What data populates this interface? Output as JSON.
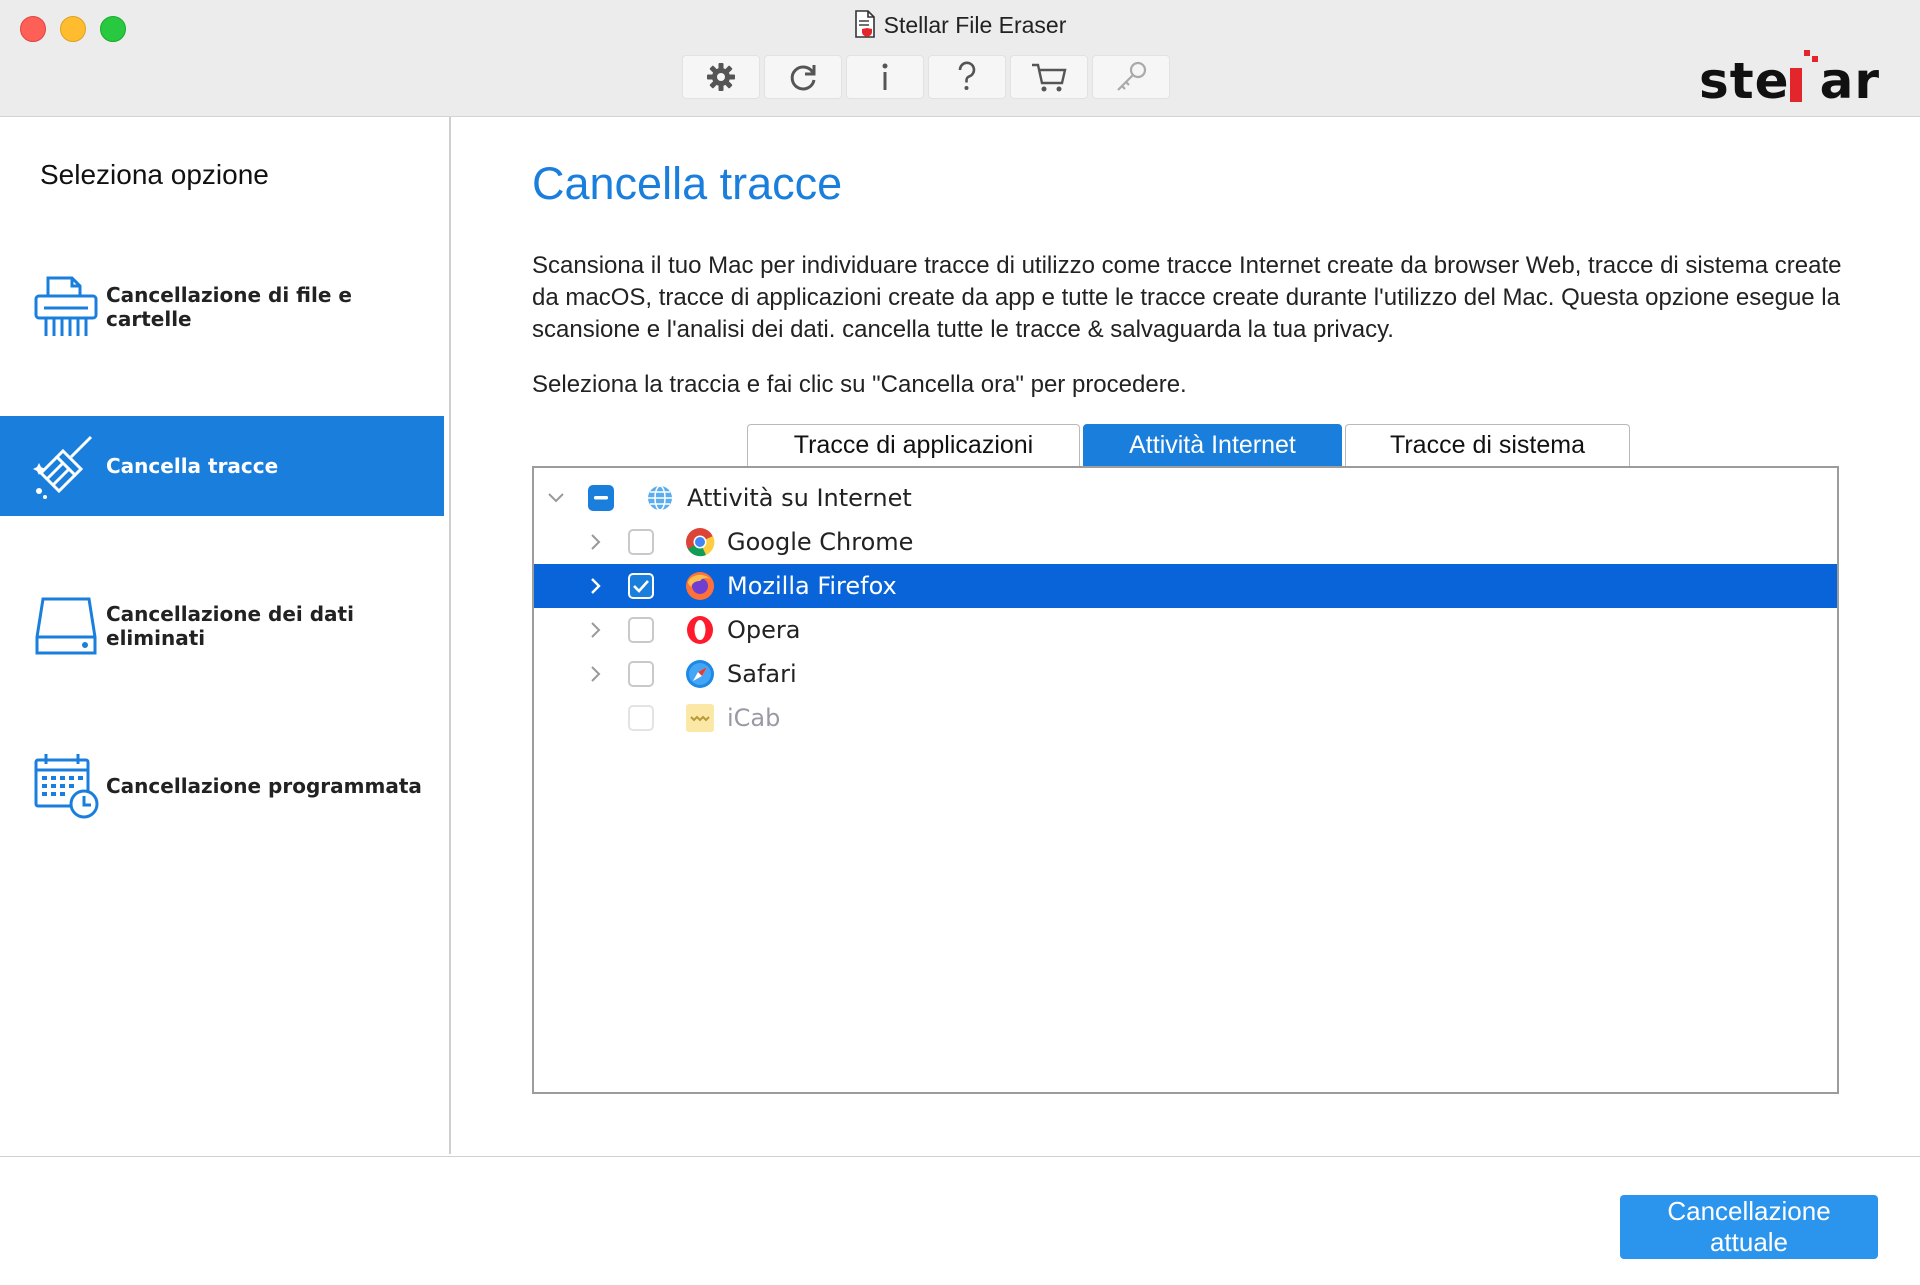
{
  "window": {
    "title": "Stellar File Eraser"
  },
  "toolbar": {
    "buttons": [
      {
        "icon": "gear-icon"
      },
      {
        "icon": "refresh-icon"
      },
      {
        "icon": "info-icon"
      },
      {
        "icon": "help-icon"
      },
      {
        "icon": "cart-icon"
      },
      {
        "icon": "key-icon"
      }
    ]
  },
  "brand": {
    "logo_text": "stellar",
    "accent_color": "#e3262b"
  },
  "sidebar": {
    "title": "Seleziona opzione",
    "items": [
      {
        "label": "Cancellazione di file e cartelle",
        "icon": "shredder-icon",
        "active": false
      },
      {
        "label": "Cancella tracce",
        "icon": "broom-icon",
        "active": true
      },
      {
        "label": "Cancellazione dei dati eliminati",
        "icon": "drive-icon",
        "active": false
      },
      {
        "label": "Cancellazione programmata",
        "icon": "calendar-clock-icon",
        "active": false
      }
    ]
  },
  "main": {
    "title": "Cancella tracce",
    "description": "Scansiona il tuo Mac per individuare tracce di utilizzo come tracce Internet create da browser Web, tracce di sistema create da macOS, tracce di applicazioni create da app e tutte le tracce create durante l'utilizzo del Mac. Questa opzione esegue la scansione e l'analisi dei dati. cancella tutte le tracce & salvaguarda la tua privacy.",
    "instruction": "Seleziona la traccia e fai clic su \"Cancella ora\" per procedere.",
    "tabs": [
      {
        "label": "Tracce di applicazioni",
        "active": false
      },
      {
        "label": "Attività Internet",
        "active": true
      },
      {
        "label": "Tracce di sistema",
        "active": false
      }
    ],
    "tree": [
      {
        "label": "Attività su Internet",
        "state": "mixed",
        "expanded": true,
        "icon": "globe-icon"
      },
      {
        "label": "Google Chrome",
        "state": "unchecked",
        "icon": "chrome-icon"
      },
      {
        "label": "Mozilla Firefox",
        "state": "checked",
        "selected": true,
        "icon": "firefox-icon"
      },
      {
        "label": "Opera",
        "state": "unchecked",
        "icon": "opera-icon"
      },
      {
        "label": "Safari",
        "state": "unchecked",
        "icon": "safari-icon"
      },
      {
        "label": "iCab",
        "state": "disabled",
        "icon": "icab-icon"
      }
    ]
  },
  "footer": {
    "action_label": "Cancellazione attuale"
  },
  "colors": {
    "accent": "#1a7fdc",
    "selection": "#0a64d9"
  }
}
